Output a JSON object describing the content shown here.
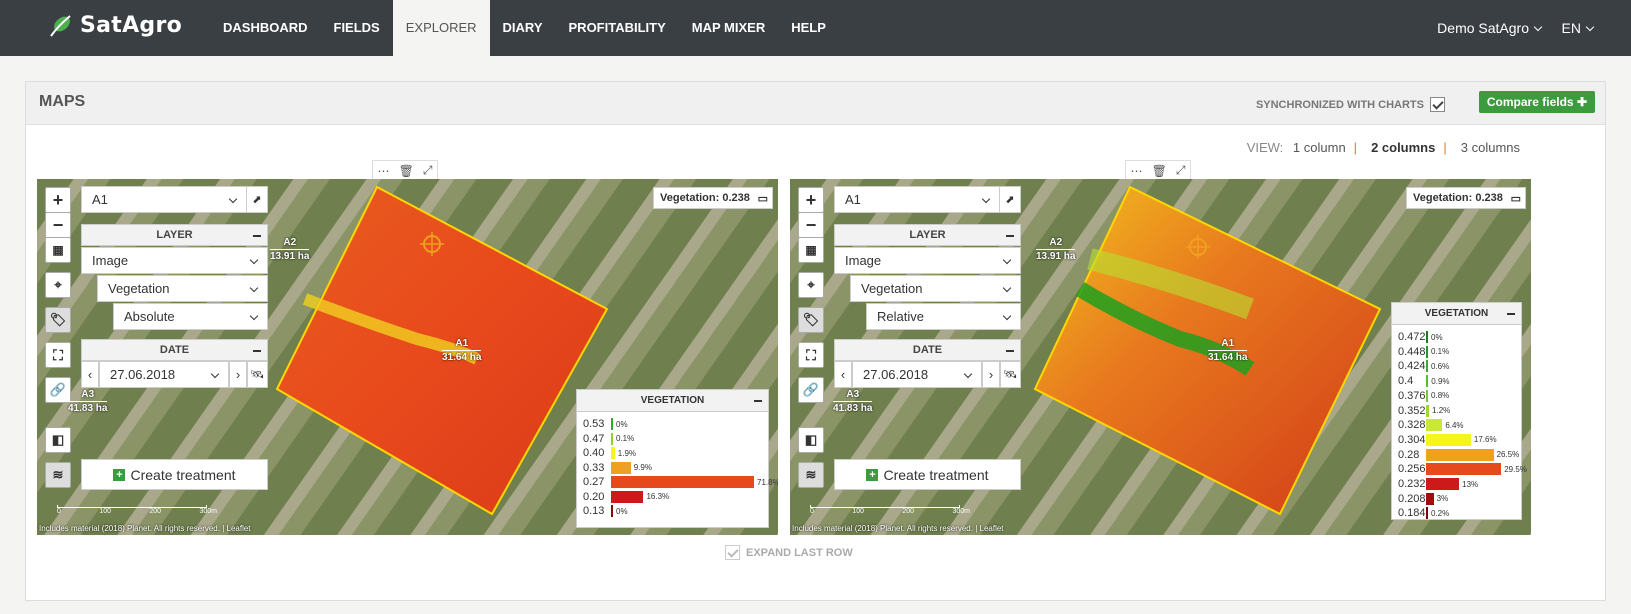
{
  "app": {
    "name": "SatAgro"
  },
  "nav": {
    "items": [
      "DASHBOARD",
      "FIELDS",
      "EXPLORER",
      "DIARY",
      "PROFITABILITY",
      "MAP MIXER",
      "HELP"
    ],
    "active": "EXPLORER",
    "user": "Demo SatAgro",
    "lang": "EN"
  },
  "panel": {
    "title": "MAPS",
    "sync_label": "SYNCHRONIZED WITH CHARTS",
    "compare_label": "Compare fields",
    "view_label": "VIEW:",
    "view_options": [
      "1 column",
      "2 columns",
      "3 columns"
    ],
    "view_selected": "2 columns",
    "expand_label": "EXPAND LAST ROW"
  },
  "maps": [
    {
      "field": "A1",
      "layer_title": "LAYER",
      "layer_type": "Image",
      "layer_index": "Vegetation",
      "layer_mode": "Absolute",
      "date_title": "DATE",
      "date": "27.06.2018",
      "create_label": "Create treatment",
      "vegetation_indicator": "Vegetation: 0.238",
      "legend_title": "VEGETATION",
      "legend": [
        {
          "value": "0.53",
          "pct": "0%",
          "frac": 0.0,
          "color": "#2eaa2e"
        },
        {
          "value": "0.47",
          "pct": "0.1%",
          "frac": 0.001,
          "color": "#8fd12a"
        },
        {
          "value": "0.40",
          "pct": "1.9%",
          "frac": 0.019,
          "color": "#f5f51a"
        },
        {
          "value": "0.33",
          "pct": "9.9%",
          "frac": 0.099,
          "color": "#f0a020"
        },
        {
          "value": "0.27",
          "pct": "71.8%",
          "frac": 0.718,
          "color": "#e5491c"
        },
        {
          "value": "0.20",
          "pct": "16.3%",
          "frac": 0.163,
          "color": "#cc1a1a"
        },
        {
          "value": "0.13",
          "pct": "0%",
          "frac": 0.0,
          "color": "#8a0a0a"
        }
      ],
      "labels": {
        "a1": "A1",
        "a1_area": "31.64 ha",
        "a2": "A2",
        "a2_area": "13.91 ha",
        "a3": "A3",
        "a3_area": "41.83 ha"
      },
      "attribution": "Includes material (2018) Planet. All rights reserved. | Leaflet",
      "scale": [
        "0",
        "100",
        "200",
        "300m"
      ]
    },
    {
      "field": "A1",
      "layer_title": "LAYER",
      "layer_type": "Image",
      "layer_index": "Vegetation",
      "layer_mode": "Relative",
      "date_title": "DATE",
      "date": "27.06.2018",
      "create_label": "Create treatment",
      "vegetation_indicator": "Vegetation: 0.238",
      "legend_title": "VEGETATION",
      "legend": [
        {
          "value": "0.472",
          "pct": "0%",
          "frac": 0.0,
          "color": "#1e7a1e"
        },
        {
          "value": "0.448",
          "pct": "0.1%",
          "frac": 0.001,
          "color": "#2a952a"
        },
        {
          "value": "0.424",
          "pct": "0.6%",
          "frac": 0.006,
          "color": "#3aaa30"
        },
        {
          "value": "0.4",
          "pct": "0.9%",
          "frac": 0.009,
          "color": "#55bb35"
        },
        {
          "value": "0.376",
          "pct": "0.8%",
          "frac": 0.008,
          "color": "#78c83a"
        },
        {
          "value": "0.352",
          "pct": "1.2%",
          "frac": 0.012,
          "color": "#9fd63e"
        },
        {
          "value": "0.328",
          "pct": "6.4%",
          "frac": 0.064,
          "color": "#c8e833"
        },
        {
          "value": "0.304",
          "pct": "17.6%",
          "frac": 0.176,
          "color": "#f5f51a"
        },
        {
          "value": "0.28",
          "pct": "26.5%",
          "frac": 0.265,
          "color": "#f0a020"
        },
        {
          "value": "0.256",
          "pct": "29.5%",
          "frac": 0.295,
          "color": "#e5491c"
        },
        {
          "value": "0.232",
          "pct": "13%",
          "frac": 0.13,
          "color": "#cc1a1a"
        },
        {
          "value": "0.208",
          "pct": "3%",
          "frac": 0.03,
          "color": "#a00d0d"
        },
        {
          "value": "0.184",
          "pct": "0.2%",
          "frac": 0.002,
          "color": "#7a0606"
        }
      ],
      "labels": {
        "a1": "A1",
        "a1_area": "31.64 ha",
        "a2": "A2",
        "a2_area": "13.91 ha",
        "a3": "A3",
        "a3_area": "41.83 ha"
      },
      "attribution": "Includes material (2018) Planet. All rights reserved. | Leaflet",
      "scale": [
        "0",
        "100",
        "200",
        "300m"
      ]
    }
  ]
}
